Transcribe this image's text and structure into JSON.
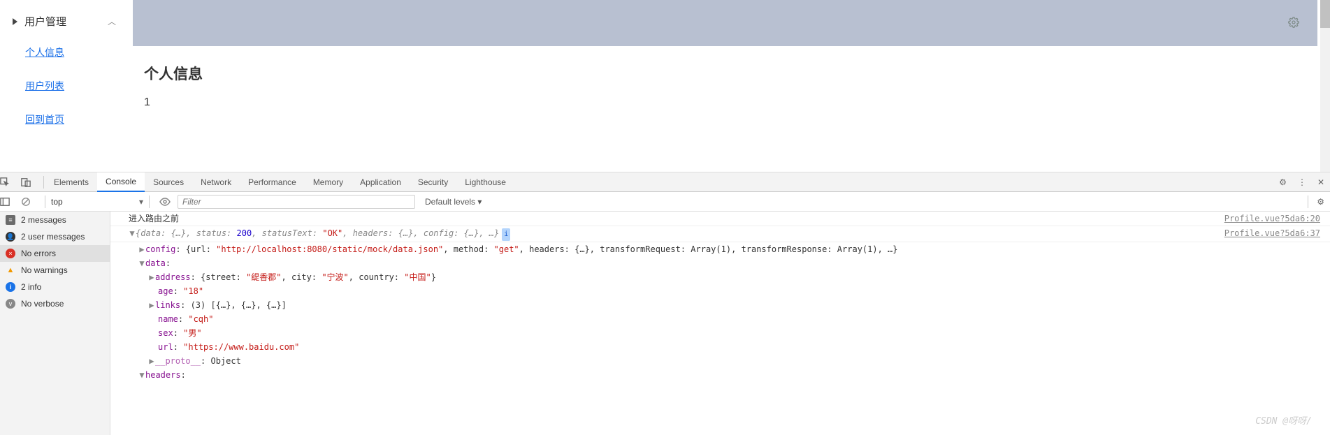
{
  "sidebar": {
    "root": "用户管理",
    "links": [
      "个人信息",
      "用户列表",
      "回到首页"
    ]
  },
  "page": {
    "title": "个人信息",
    "value": "1"
  },
  "devtools": {
    "tabs": [
      "Elements",
      "Console",
      "Sources",
      "Network",
      "Performance",
      "Memory",
      "Application",
      "Security",
      "Lighthouse"
    ],
    "active_tab": "Console",
    "toolbar": {
      "context": "top",
      "filter_placeholder": "Filter",
      "levels": "Default levels ▾"
    },
    "sidebar": [
      {
        "icon": "msg",
        "label": "2 messages"
      },
      {
        "icon": "user",
        "label": "2 user messages"
      },
      {
        "icon": "err",
        "label": "No errors"
      },
      {
        "icon": "warn",
        "label": "No warnings"
      },
      {
        "icon": "info",
        "label": "2 info"
      },
      {
        "icon": "verb",
        "label": "No verbose"
      }
    ],
    "console": {
      "line1": "进入路由之前",
      "src1": "Profile.vue?5da6:20",
      "src2": "Profile.vue?5da6:37",
      "summary_pre": "{data: {…}, status: ",
      "summary_status": "200",
      "summary_mid": ", statusText: ",
      "summary_statusText": "\"OK\"",
      "summary_post": ", headers: {…}, config: {…}, …}",
      "badge": "i",
      "config_key": "config",
      "config_pre": ": {url: ",
      "config_url": "\"http://localhost:8080/static/mock/data.json\"",
      "config_mid": ", method: ",
      "config_method": "\"get\"",
      "config_post": ", headers: {…}, transformRequest: Array(1), transformResponse: Array(1), …}",
      "data_key": "data",
      "addr_key": "address",
      "addr_pre": ": {street: ",
      "addr_street": "\"缇香郡\"",
      "addr_mid1": ", city: ",
      "addr_city": "\"宁波\"",
      "addr_mid2": ", country: ",
      "addr_country": "\"中国\"",
      "addr_post": "}",
      "age_key": "age",
      "age_val": "\"18\"",
      "links_key": "links",
      "links_val": ": (3) [{…}, {…}, {…}]",
      "name_key": "name",
      "name_val": "\"cqh\"",
      "sex_key": "sex",
      "sex_val": "\"男\"",
      "url_key": "url",
      "url_val": "\"https://www.baidu.com\"",
      "proto_key": "__proto__",
      "proto_val": ": Object",
      "headers_key": "headers",
      "headers_val": ":"
    },
    "watermark": "CSDN @呀呀/"
  }
}
